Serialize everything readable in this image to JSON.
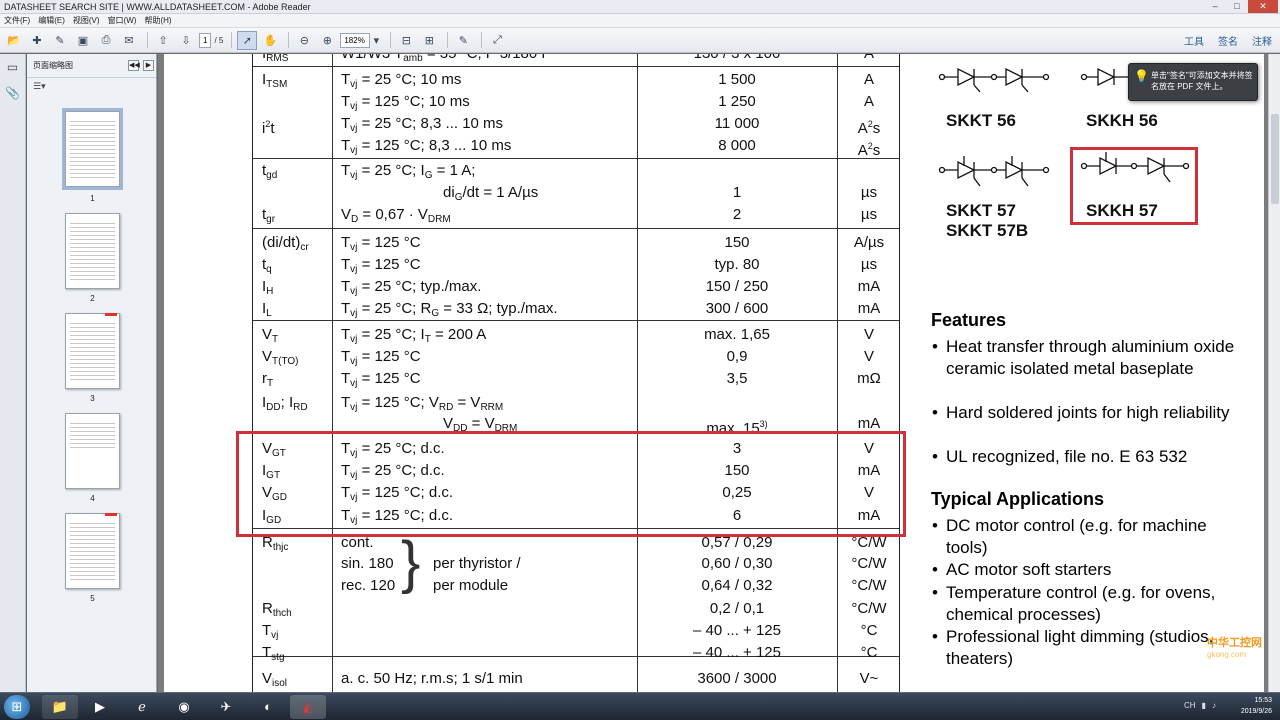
{
  "window": {
    "title": "DATASHEET SEARCH SITE | WWW.ALLDATASHEET.COM - Adobe Reader",
    "controls": [
      "–",
      "□",
      "✕"
    ]
  },
  "menu": [
    "文件(F)",
    "编辑(E)",
    "视图(V)",
    "窗口(W)",
    "帮助(H)"
  ],
  "toolbar": {
    "page_current": "1",
    "page_total": "/ 5",
    "zoom": "182%",
    "right": [
      "工具",
      "签名",
      "注释"
    ]
  },
  "thumbnails": {
    "panel_title": "页面缩略图",
    "pages": [
      "1",
      "2",
      "3",
      "4",
      "5"
    ]
  },
  "table": {
    "partial_row": {
      "sym": "I",
      "sym_sub": "RMS",
      "cond": "W1/W3   T",
      "cond_sub": "amb",
      "cond_rest": " = 35 °C;  P 3/180 F",
      "val": "130 / 3 x 100",
      "unit": "A"
    },
    "rows": [
      {
        "sym": "I",
        "sub": "TSM",
        "cond": "T",
        "csub": "vj",
        "crest": " =   25 °C; 10 ms",
        "val": "1 500",
        "unit": "A"
      },
      {
        "sym": "",
        "sub": "",
        "cond": "T",
        "csub": "vj",
        "crest": " = 125 °C; 10 ms",
        "val": "1 250",
        "unit": "A"
      },
      {
        "sym": "i",
        "sup": "2",
        "symrest": "t",
        "cond": "T",
        "csub": "vj",
        "crest": " =   25 °C; 8,3 ... 10 ms",
        "val": "11 000",
        "unit": "A",
        "usup": "2",
        "urest": "s"
      },
      {
        "sym": "",
        "cond": "T",
        "csub": "vj",
        "crest": " = 125 °C; 8,3 ... 10 ms",
        "val": "8 000",
        "unit": "A",
        "usup": "2",
        "urest": "s"
      },
      {
        "sym": "t",
        "sub": "gd",
        "cond": "T",
        "csub": "vj",
        "crest": " =   25 °C;   I",
        "csub2": "G",
        "crest2": " = 1 A;",
        "val": "",
        "unit": ""
      },
      {
        "sym": "",
        "cond": "di",
        "csub": "G",
        "crest": "/dt = 1 A/µs",
        "val": "1",
        "unit": "µs",
        "indent": true
      },
      {
        "sym": "t",
        "sub": "gr",
        "cond": "V",
        "csub": "D",
        "crest": " = 0,67 · V",
        "csub2": "DRM",
        "crest2": "",
        "val": "2",
        "unit": "µs"
      },
      {
        "sym": "(di/dt)",
        "sub": "cr",
        "cond": "T",
        "csub": "vj",
        "crest": " = 125 °C",
        "val": "150",
        "unit": "A/µs"
      },
      {
        "sym": "t",
        "sub": "q",
        "cond": "T",
        "csub": "vj",
        "crest": " = 125 °C",
        "val": "typ. 80",
        "unit": "µs"
      },
      {
        "sym": "I",
        "sub": "H",
        "cond": "T",
        "csub": "vj",
        "crest": " =   25 °C; typ./max.",
        "val": "150 / 250",
        "unit": "mA"
      },
      {
        "sym": "I",
        "sub": "L",
        "cond": "T",
        "csub": "vj",
        "crest": " =   25 °C; R",
        "csub2": "G",
        "crest2": " = 33 Ω; typ./max.",
        "val": "300 / 600",
        "unit": "mA"
      },
      {
        "sym": "V",
        "sub": "T",
        "cond": "T",
        "csub": "vj",
        "crest": " =   25 °C; I",
        "csub2": "T",
        "crest2": " = 200 A",
        "val": "max. 1,65",
        "unit": "V"
      },
      {
        "sym": "V",
        "sub": "T(TO)",
        "cond": "T",
        "csub": "vj",
        "crest": " = 125 °C",
        "val": "0,9",
        "unit": "V"
      },
      {
        "sym": "r",
        "sub": "T",
        "cond": "T",
        "csub": "vj",
        "crest": " = 125 °C",
        "val": "3,5",
        "unit": "mΩ"
      },
      {
        "sym": "I",
        "sub": "DD",
        "symrest": "; I",
        "sub2": "RD",
        "cond": "T",
        "csub": "vj",
        "crest": " = 125 °C;   V",
        "csub2": "RD",
        "crest2": " = V",
        "csub3": "RRM",
        "val": "",
        "unit": ""
      },
      {
        "sym": "",
        "cond": "V",
        "csub": "DD",
        "crest": " = V",
        "csub2": "DRM",
        "crest2": "",
        "val": "max. 15",
        "vsup": "3)",
        "unit": "mA",
        "indent": true
      },
      {
        "sym": "V",
        "sub": "GT",
        "cond": "T",
        "csub": "vj",
        "crest": " =   25 °C; d.c.",
        "val": "3",
        "unit": "V"
      },
      {
        "sym": "I",
        "sub": "GT",
        "cond": "T",
        "csub": "vj",
        "crest": " =   25 °C; d.c.",
        "val": "150",
        "unit": "mA"
      },
      {
        "sym": "V",
        "sub": "GD",
        "cond": "T",
        "csub": "vj",
        "crest": " = 125 °C; d.c.",
        "val": "0,25",
        "unit": "V"
      },
      {
        "sym": "I",
        "sub": "GD",
        "cond": "T",
        "csub": "vj",
        "crest": " = 125 °C; d.c.",
        "val": "6",
        "unit": "mA"
      },
      {
        "sym": "R",
        "sub": "thjc",
        "cond": "cont.",
        "val": "0,57 / 0,29",
        "unit": "°C/W"
      },
      {
        "sym": "",
        "cond": "sin. 180",
        "cond2": "per thyristor /",
        "val": "0,60 / 0,30",
        "unit": "°C/W"
      },
      {
        "sym": "",
        "cond": "rec. 120",
        "cond2": "per module",
        "val": "0,64 / 0,32",
        "unit": "°C/W"
      },
      {
        "sym": "R",
        "sub": "thch",
        "cond": "",
        "val": "0,2 / 0,1",
        "unit": "°C/W"
      },
      {
        "sym": "T",
        "sub": "vj",
        "cond": "",
        "val": "– 40 ... + 125",
        "unit": "°C"
      },
      {
        "sym": "T",
        "sub": "stg",
        "cond": "",
        "val": "– 40 ... + 125",
        "unit": "°C"
      },
      {
        "sym": "V",
        "sub": "isol",
        "cond": "a. c. 50 Hz; r.m.s; 1 s/1 min",
        "val": "3600 / 3000",
        "unit": "V~"
      }
    ]
  },
  "packages": [
    "SKKT 56",
    "SKKH 56",
    "SKKT 57",
    "SKKT 57B",
    "SKKH 57"
  ],
  "features": {
    "title": "Features",
    "items": [
      "Heat transfer through aluminium oxide ceramic isolated metal baseplate",
      "Hard soldered joints for high reliability",
      "UL recognized, file no. E 63 532"
    ]
  },
  "applications": {
    "title": "Typical Applications",
    "items": [
      "DC motor control (e.g. for machine tools)",
      "AC motor soft starters",
      "Temperature control (e.g. for ovens, chemical processes)",
      "Professional light dimming (studios, theaters)"
    ]
  },
  "tooltip": "单击\"签名\"可添加文本并将签名放在 PDF 文件上。",
  "taskbar": {
    "time": "15:53",
    "date": "2019/9/26",
    "tray_lang": "CH"
  },
  "watermark": {
    "title": "中华工控网",
    "url": "gkong.com"
  },
  "colors": {
    "highlight": "#d0303a"
  }
}
